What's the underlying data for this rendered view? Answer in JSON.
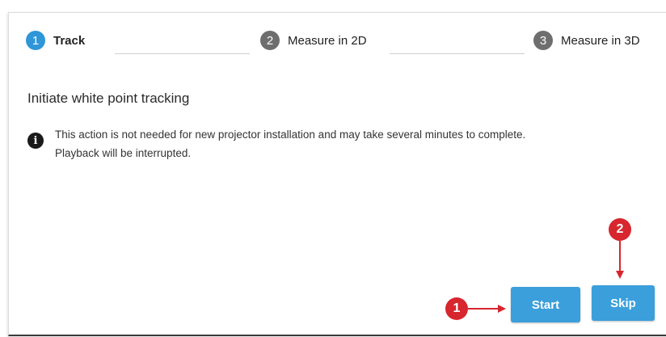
{
  "stepper": {
    "steps": [
      {
        "number": "1",
        "label": "Track",
        "active": true,
        "color": "#2f96d8"
      },
      {
        "number": "2",
        "label": "Measure in 2D",
        "active": false,
        "color": "#6e6e6e"
      },
      {
        "number": "3",
        "label": "Measure in 3D",
        "active": false,
        "color": "#6e6e6e"
      }
    ]
  },
  "content": {
    "heading": "Initiate white point tracking",
    "info_icon": "info-icon",
    "info_lines": [
      "This action is not needed for new projector installation and may take several minutes to complete.",
      "Playback will be interrupted."
    ]
  },
  "actions": {
    "start_label": "Start",
    "skip_label": "Skip",
    "button_color": "#3b9fdb"
  },
  "callouts": {
    "start_marker": "1",
    "skip_marker": "2",
    "color": "#d7262e"
  }
}
